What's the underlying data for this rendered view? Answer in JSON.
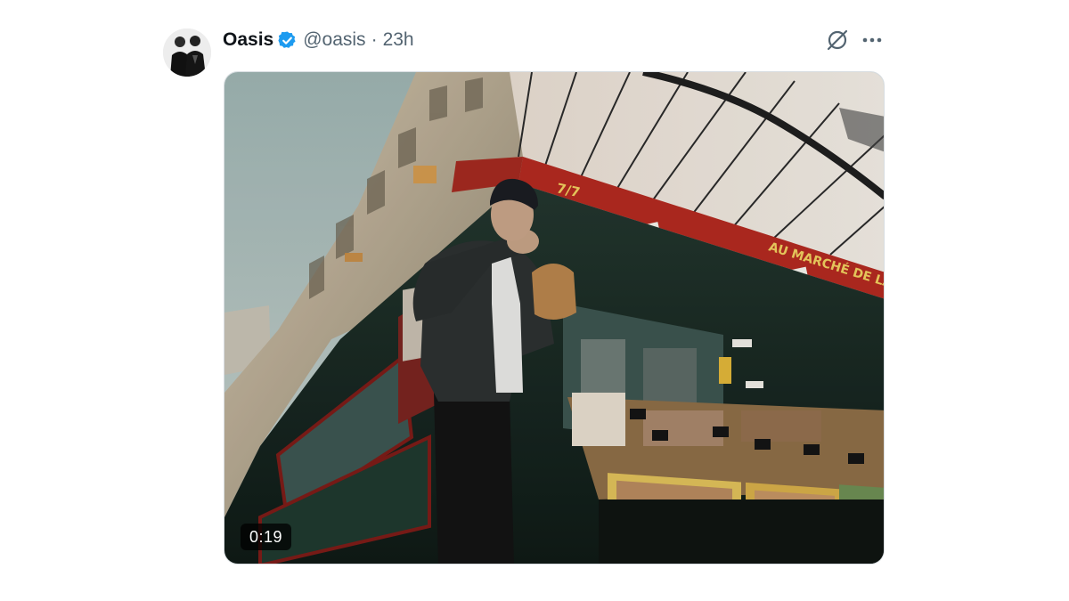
{
  "post": {
    "author_name": "Oasis",
    "handle": "@oasis",
    "separator": "·",
    "time": "23h",
    "verified": true,
    "accent_color": "#1d9bf0"
  },
  "header_icons": [
    "grok-icon",
    "more-icon"
  ],
  "media": {
    "kind": "video",
    "duration": "0:19",
    "storefront_sign": "AU MARCHÉ DE LA",
    "sign_number": "7/7"
  }
}
